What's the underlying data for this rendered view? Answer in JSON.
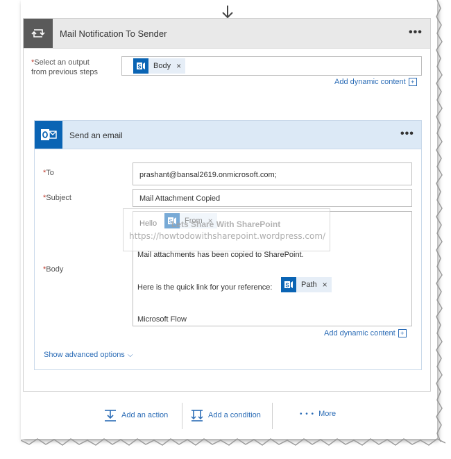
{
  "flow_step": {
    "title": "Mail Notification To Sender",
    "menu": "•••",
    "select_output_label_line1": "Select an output",
    "select_output_label_line2": "from previous steps",
    "required_mark": "*",
    "output_token": "Body",
    "token_remove": "×",
    "add_dynamic_content": "Add dynamic content",
    "add_dynamic_icon": "plus-box-icon"
  },
  "email_action": {
    "title": "Send an email",
    "menu": "•••",
    "to_label": "To",
    "to_value": "prashant@bansal2619.onmicrosoft.com;",
    "subject_label": "Subject",
    "subject_value": "Mail Attachment Copied",
    "body_label": "Body",
    "body_greeting": "Hello",
    "body_from_token": "From",
    "body_line2": "Mail attachments has been copied to SharePoint.",
    "body_line3": "Here is the quick link for your reference:",
    "body_path_token": "Path",
    "body_signature": "Microsoft Flow",
    "token_remove": "×",
    "add_dynamic_content": "Add dynamic content",
    "show_advanced": "Show advanced options",
    "show_advanced_chevron": "⌵"
  },
  "watermark": {
    "line1": "Lets Share With SharePoint",
    "line2": "https://howtodowithsharepoint.wordpress.com/"
  },
  "actions": {
    "add_action": "Add an action",
    "add_condition": "Add a condition",
    "more_dots": "• • •",
    "more": "More"
  },
  "colors": {
    "accent": "#0a64b4",
    "link": "#2b6cb6",
    "required": "#c0392b",
    "header_gray": "#e9e9e9",
    "email_header": "#dce9f6"
  }
}
